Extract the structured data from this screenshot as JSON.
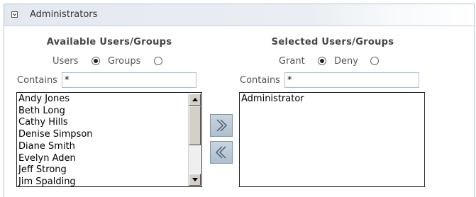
{
  "panel": {
    "title": "Administrators"
  },
  "available": {
    "title": "Available Users/Groups",
    "radio_users_label": "Users",
    "radio_groups_label": "Groups",
    "selected_radio": "Users",
    "contains_label": "Contains",
    "contains_value": "*",
    "items": [
      "Andy Jones",
      "Beth Long",
      "Cathy Hills",
      "Denise Simpson",
      "Diane Smith",
      "Evelyn Aden",
      "Jeff Strong",
      "Jim Spalding"
    ]
  },
  "selected": {
    "title": "Selected Users/Groups",
    "radio_grant_label": "Grant",
    "radio_deny_label": "Deny",
    "selected_radio": "Grant",
    "contains_label": "Contains",
    "contains_value": "*",
    "items": [
      "Administrator"
    ]
  },
  "buttons": {
    "add_icon": "double-chevron-right-icon",
    "remove_icon": "double-chevron-left-icon"
  },
  "colors": {
    "header_bg": "#e3e9ef",
    "button_bg": "#b8c8d6",
    "input_border": "#a9c0d6"
  }
}
